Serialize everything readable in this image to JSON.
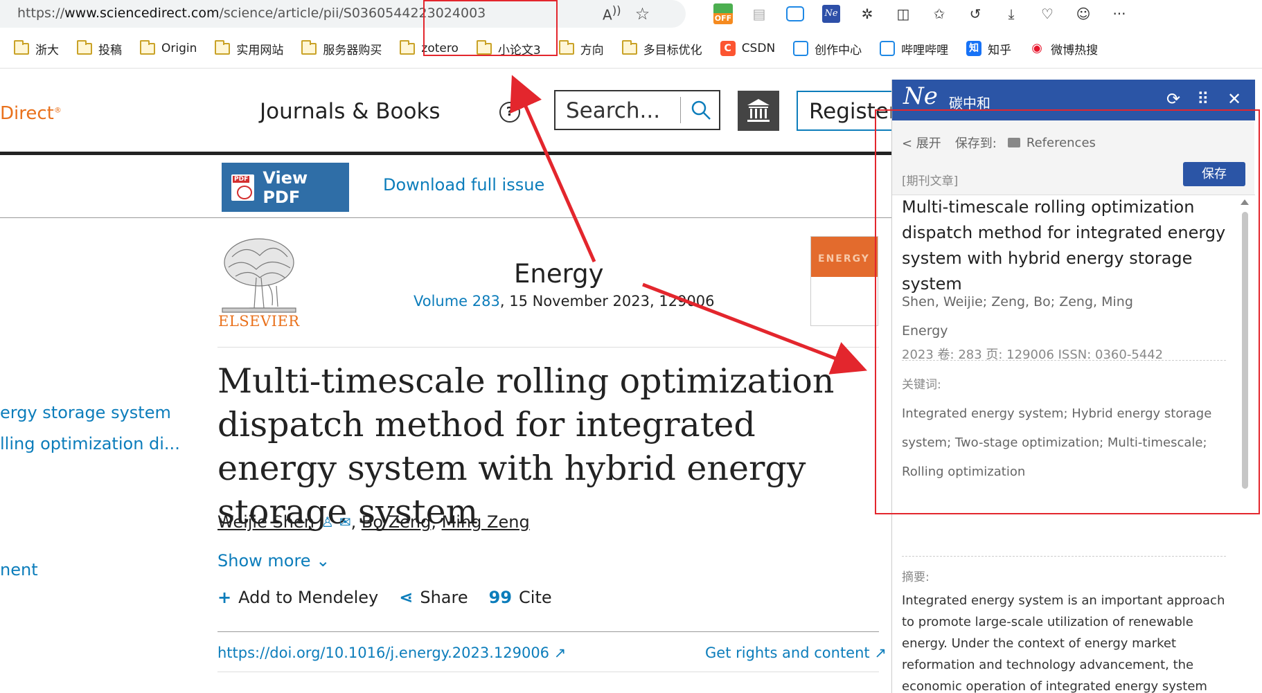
{
  "browser": {
    "url_prefix": "https://",
    "url_domain": "www.sciencedirect.com",
    "url_path": "/science/article/pii/S0360544223024003",
    "off_badge": "OFF",
    "ne_icon": "Ne"
  },
  "bookmarks": [
    {
      "label": "浙大",
      "icon": "folder-icon"
    },
    {
      "label": "投稿",
      "icon": "folder-icon"
    },
    {
      "label": "Origin",
      "icon": "folder-icon"
    },
    {
      "label": "实用网站",
      "icon": "folder-icon"
    },
    {
      "label": "服务器购买",
      "icon": "folder-icon"
    },
    {
      "label": "zotero",
      "icon": "folder-icon"
    },
    {
      "label": "小论文3",
      "icon": "folder-icon"
    },
    {
      "label": "方向",
      "icon": "folder-icon"
    },
    {
      "label": "多目标优化",
      "icon": "folder-icon"
    },
    {
      "label": "CSDN",
      "icon": "csdn-icon"
    },
    {
      "label": "创作中心",
      "icon": "bilibili-icon"
    },
    {
      "label": "哔哩哔哩",
      "icon": "bilibili-icon"
    },
    {
      "label": "知乎",
      "icon": "zhihu-icon"
    },
    {
      "label": "微博热搜",
      "icon": "weibo-icon"
    }
  ],
  "site": {
    "brand": "Direct",
    "brand_mark": "®",
    "nav_journals": "Journals & Books",
    "help_glyph": "?",
    "search_placeholder": "Search...",
    "register": "Register",
    "view_pdf": "View PDF",
    "pdf_badge": "PDF",
    "download_issue": "Download full issue",
    "publisher": "ELSEVIER",
    "cover_word": "ENERGY",
    "journal": "Energy",
    "volume_link": "Volume 283",
    "volume_rest": ", 15 November 2023, 129006",
    "title": "Multi-timescale rolling optimization dispatch method for integrated energy system with hybrid energy storage system",
    "authors": [
      "Weijie Shen",
      "Bo Zeng",
      "Ming Zeng"
    ],
    "show_more": "Show more",
    "add_mendeley": "Add to Mendeley",
    "share": "Share",
    "cite": "Cite",
    "cite_glyph": "99",
    "doi": "https://doi.org/10.1016/j.energy.2023.129006",
    "rights": "Get rights and content",
    "outline": [
      "ergy storage system",
      "lling optimization di...",
      "nent"
    ]
  },
  "panel": {
    "logo": "Ne",
    "name": "碳中和",
    "expand": "< 展开",
    "save_to": "保存到:",
    "folder": "References",
    "save_button": "保存",
    "type": "[期刊文章]",
    "title": "Multi-timescale rolling optimization dispatch method for integrated energy system with hybrid energy storage system",
    "authors": "Shen, Weijie; Zeng, Bo; Zeng, Ming",
    "journal": "Energy",
    "meta": "2023  卷: 283    页: 129006    ISSN: 0360-5442",
    "keywords_label": "关键词:",
    "keywords": "Integrated energy system; Hybrid energy storage system; Two-stage optimization; Multi-timescale; Rolling optimization",
    "abstract_label": "摘要:",
    "abstract": "Integrated energy system is an important approach to promote large-scale utilization of renewable energy. Under the context of energy market reformation and technology advancement, the economic operation of integrated energy system confronts new challenges, in"
  },
  "colors": {
    "accent_blue": "#0c7dbb",
    "panel_blue": "#2b55a6",
    "annotation_red": "#e3262d",
    "elsevier_orange": "#e9711c"
  }
}
